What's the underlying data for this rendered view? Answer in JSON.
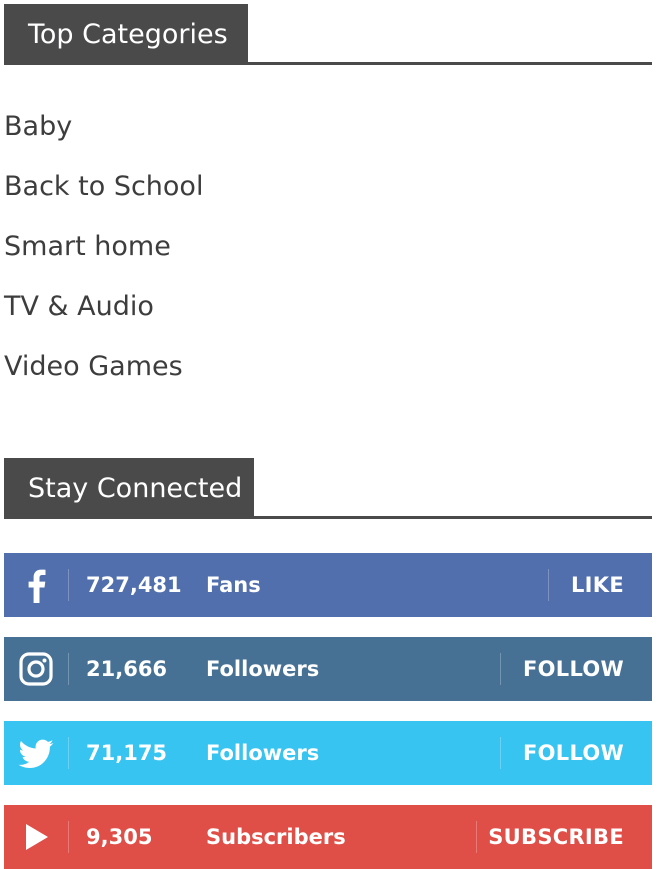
{
  "top_categories": {
    "title": "Top Categories",
    "items": [
      "Baby",
      "Back to School",
      "Smart home",
      "TV & Audio",
      "Video Games"
    ]
  },
  "stay_connected": {
    "title": "Stay Connected",
    "rows": [
      {
        "network": "facebook",
        "icon": "facebook-icon",
        "count": "727,481",
        "unit": "Fans",
        "action": "LIKE",
        "color": "#516fac"
      },
      {
        "network": "instagram",
        "icon": "instagram-icon",
        "count": "21,666",
        "unit": "Followers",
        "action": "FOLLOW",
        "color": "#467195"
      },
      {
        "network": "twitter",
        "icon": "twitter-icon",
        "count": "71,175",
        "unit": "Followers",
        "action": "FOLLOW",
        "color": "#37c4f1"
      },
      {
        "network": "youtube",
        "icon": "youtube-icon",
        "count": "9,305",
        "unit": "Subscribers",
        "action": "SUBSCRIBE",
        "color": "#e04e48"
      }
    ]
  },
  "colors": {
    "header_bg": "#4a4a4b",
    "text": "#3d3d3d"
  }
}
